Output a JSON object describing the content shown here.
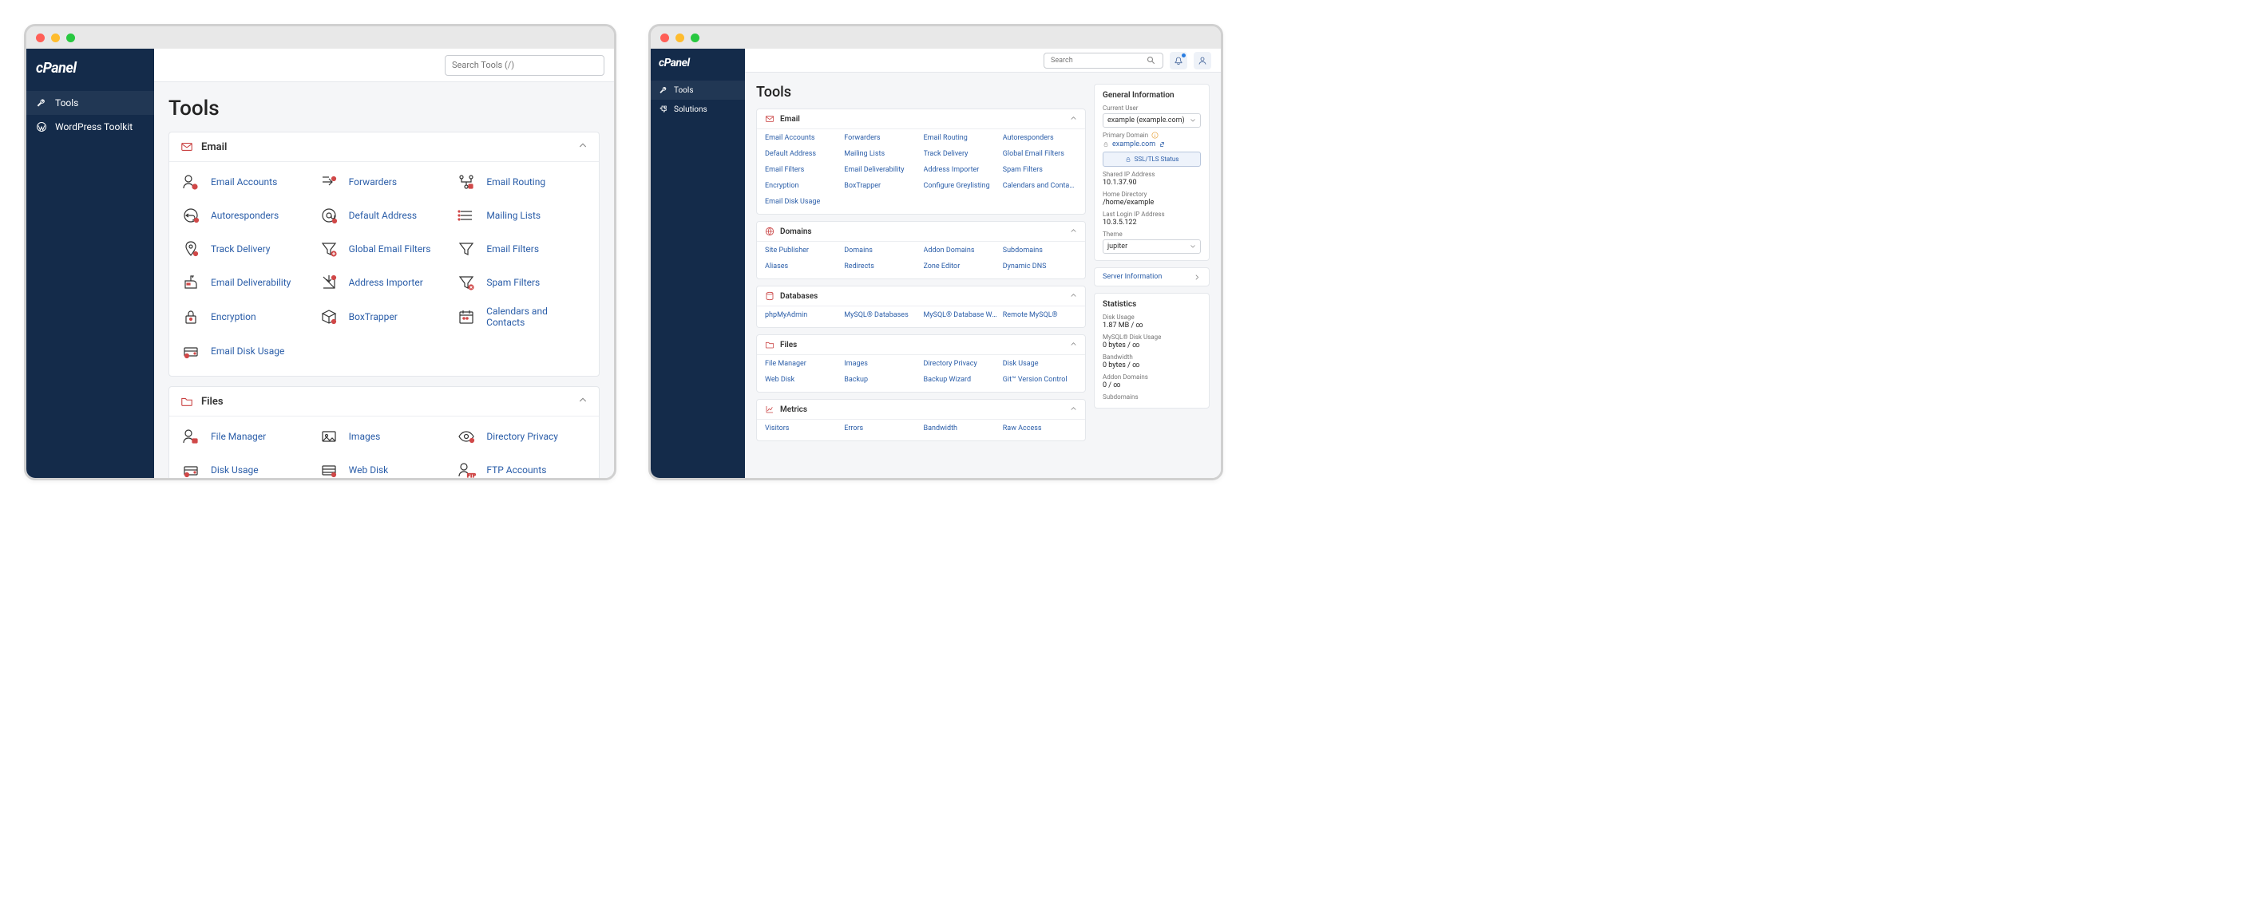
{
  "left": {
    "logo": "cPanel",
    "nav": [
      {
        "id": "tools",
        "label": "Tools"
      },
      {
        "id": "wordpress",
        "label": "WordPress Toolkit"
      }
    ],
    "search_placeholder": "Search Tools (/)",
    "page_title": "Tools",
    "groups": [
      {
        "id": "email",
        "title": "Email",
        "items": [
          {
            "label": "Email Accounts",
            "icon": "user-mail"
          },
          {
            "label": "Forwarders",
            "icon": "forward"
          },
          {
            "label": "Email Routing",
            "icon": "route"
          },
          {
            "label": "Autoresponders",
            "icon": "reply"
          },
          {
            "label": "Default Address",
            "icon": "at"
          },
          {
            "label": "Mailing Lists",
            "icon": "list"
          },
          {
            "label": "Track Delivery",
            "icon": "pin"
          },
          {
            "label": "Global Email Filters",
            "icon": "funnel-plus"
          },
          {
            "label": "Email Filters",
            "icon": "funnel"
          },
          {
            "label": "Email Deliverability",
            "icon": "mailbox"
          },
          {
            "label": "Address Importer",
            "icon": "import"
          },
          {
            "label": "Spam Filters",
            "icon": "funnel-x"
          },
          {
            "label": "Encryption",
            "icon": "lock"
          },
          {
            "label": "BoxTrapper",
            "icon": "box"
          },
          {
            "label": "Calendars and Contacts",
            "icon": "calendar"
          },
          {
            "label": "Email Disk Usage",
            "icon": "disk-mail"
          }
        ]
      },
      {
        "id": "files",
        "title": "Files",
        "items": [
          {
            "label": "File Manager",
            "icon": "user-file"
          },
          {
            "label": "Images",
            "icon": "image"
          },
          {
            "label": "Directory Privacy",
            "icon": "eye"
          },
          {
            "label": "Disk Usage",
            "icon": "disk"
          },
          {
            "label": "Web Disk",
            "icon": "webdisk"
          },
          {
            "label": "FTP Accounts",
            "icon": "ftp"
          }
        ]
      }
    ]
  },
  "right": {
    "logo": "cPanel",
    "nav": [
      {
        "id": "tools",
        "label": "Tools"
      },
      {
        "id": "solutions",
        "label": "Solutions"
      }
    ],
    "search_placeholder": "Search",
    "page_title": "Tools",
    "groups": [
      {
        "id": "email",
        "title": "Email",
        "items": [
          "Email Accounts",
          "Forwarders",
          "Email Routing",
          "Autoresponders",
          "Default Address",
          "Mailing Lists",
          "Track Delivery",
          "Global Email Filters",
          "Email Filters",
          "Email Deliverability",
          "Address Importer",
          "Spam Filters",
          "Encryption",
          "BoxTrapper",
          "Configure Greylisting",
          "Calendars and Contacts",
          "Email Disk Usage"
        ]
      },
      {
        "id": "domains",
        "title": "Domains",
        "items": [
          "Site Publisher",
          "Domains",
          "Addon Domains",
          "Subdomains",
          "Aliases",
          "Redirects",
          "Zone Editor",
          "Dynamic DNS"
        ]
      },
      {
        "id": "databases",
        "title": "Databases",
        "items": [
          "phpMyAdmin",
          "MySQL® Databases",
          "MySQL® Database Wizard",
          "Remote MySQL®"
        ]
      },
      {
        "id": "files",
        "title": "Files",
        "items": [
          "File Manager",
          "Images",
          "Directory Privacy",
          "Disk Usage",
          "Web Disk",
          "Backup",
          "Backup Wizard",
          "Git™ Version Control"
        ]
      },
      {
        "id": "metrics",
        "title": "Metrics",
        "items": [
          "Visitors",
          "Errors",
          "Bandwidth",
          "Raw Access"
        ]
      }
    ],
    "info": {
      "heading": "General Information",
      "current_user_label": "Current User",
      "current_user": "example (example.com)",
      "primary_domain_label": "Primary Domain",
      "primary_domain": "example.com",
      "ssl_button": "SSL/TLS Status",
      "shared_ip_label": "Shared IP Address",
      "shared_ip": "10.1.37.90",
      "home_dir_label": "Home Directory",
      "home_dir": "/home/example",
      "last_login_label": "Last Login IP Address",
      "last_login": "10.3.5.122",
      "theme_label": "Theme",
      "theme": "jupiter",
      "server_info": "Server Information"
    },
    "stats": {
      "heading": "Statistics",
      "rows": [
        {
          "label": "Disk Usage",
          "value": "1.87 MB / ∞"
        },
        {
          "label": "MySQL® Disk Usage",
          "value": "0 bytes / ∞"
        },
        {
          "label": "Bandwidth",
          "value": "0 bytes / ∞"
        },
        {
          "label": "Addon Domains",
          "value": "0 / ∞"
        },
        {
          "label": "Subdomains",
          "value": ""
        }
      ]
    }
  }
}
